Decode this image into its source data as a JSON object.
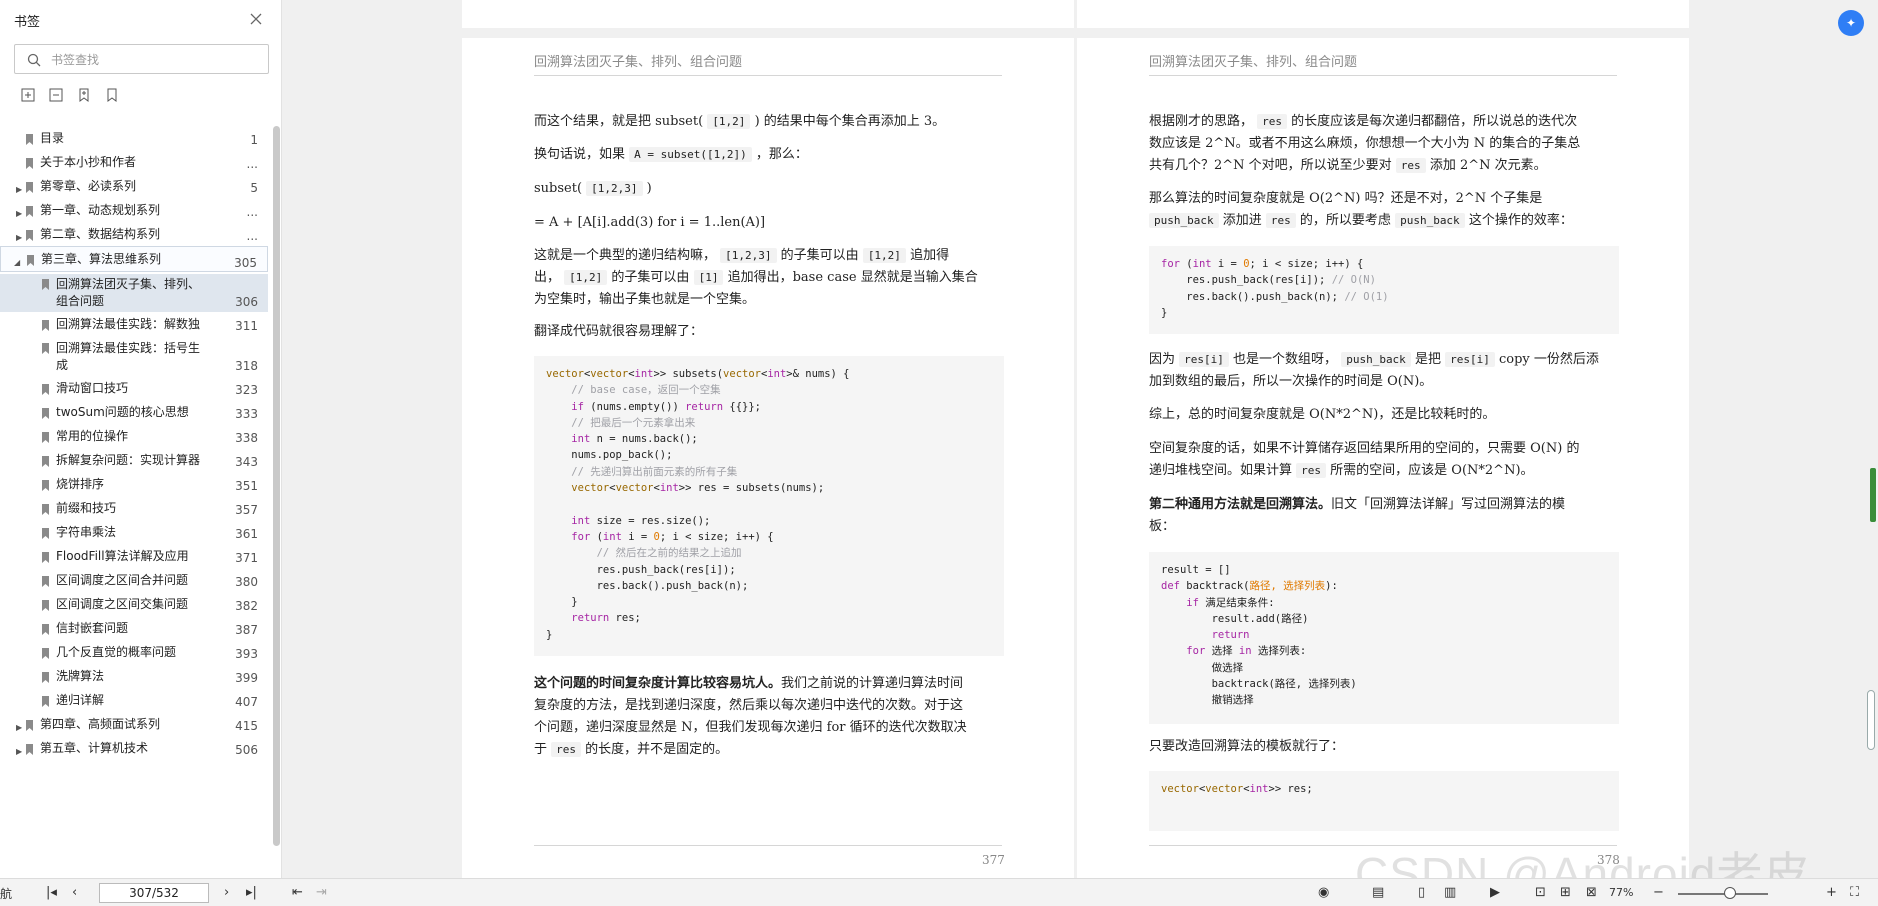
{
  "sidebar": {
    "title": "书签",
    "search_placeholder": "书签查找",
    "bookmarks": [
      {
        "label": "目录",
        "page": "1"
      },
      {
        "label": "关于本小抄和作者",
        "page": "..."
      },
      {
        "label": "第零章、必读系列",
        "page": "5"
      },
      {
        "label": "第一章、动态规划系列",
        "page": "..."
      },
      {
        "label": "第二章、数据结构系列",
        "page": "..."
      },
      {
        "label": "第三章、算法思维系列",
        "page": "305"
      },
      {
        "label": "回溯算法团灭子集、排列、",
        "label2": "组合问题",
        "page": "306"
      },
      {
        "label": "回溯算法最佳实践：解数独",
        "page": "311"
      },
      {
        "label": "回溯算法最佳实践：括号生",
        "label2": "成",
        "page": "318"
      },
      {
        "label": "滑动窗口技巧",
        "page": "323"
      },
      {
        "label": "twoSum问题的核心思想",
        "page": "333"
      },
      {
        "label": "常用的位操作",
        "page": "338"
      },
      {
        "label": "拆解复杂问题：实现计算器",
        "page": "343"
      },
      {
        "label": "烧饼排序",
        "page": "351"
      },
      {
        "label": "前缀和技巧",
        "page": "357"
      },
      {
        "label": "字符串乘法",
        "page": "361"
      },
      {
        "label": "FloodFill算法详解及应用",
        "page": "371"
      },
      {
        "label": "区间调度之区间合并问题",
        "page": "380"
      },
      {
        "label": "区间调度之区间交集问题",
        "page": "382"
      },
      {
        "label": "信封嵌套问题",
        "page": "387"
      },
      {
        "label": "几个反直觉的概率问题",
        "page": "393"
      },
      {
        "label": "洗牌算法",
        "page": "399"
      },
      {
        "label": "递归详解",
        "page": "407"
      },
      {
        "label": "第四章、高频面试系列",
        "page": "415"
      },
      {
        "label": "第五章、计算机技术",
        "page": "506"
      }
    ]
  },
  "left_page": {
    "running_head": "回溯算法团灭子集、排列、组合问题",
    "p1_a": "而这个结果，就是把 subset(",
    "p1_code": "[1,2]",
    "p1_b": ") 的结果中每个集合再添加上 3。",
    "p2_a": "换句话说，如果",
    "p2_code": "A = subset([1,2])",
    "p2_b": "，那么：",
    "p3_a": "subset(",
    "p3_code": "[1,2,3]",
    "p3_b": ")",
    "p4": "= A + [A[i].add(3) for i = 1..len(A)]",
    "p5_a": "这就是一个典型的递归结构嘛，",
    "p5_c1": "[1,2,3]",
    "p5_b": "的子集可以由",
    "p5_c2": "[1,2]",
    "p5_c": "追加得",
    "p5_d": "出，",
    "p5_c3": "[1,2]",
    "p5_e": "的子集可以由",
    "p5_c4": "[1]",
    "p5_f": "追加得出，base case 显然就是当输入集合",
    "p5_g": "为空集时，输出子集也就是一个空集。",
    "p6": "翻译成代码就很容易理解了：",
    "code_lines": [
      "vector<vector<int>> subsets(vector<int>& nums) {",
      "    // base case，返回一个空集",
      "    if (nums.empty()) return {{}};",
      "    // 把最后一个元素拿出来",
      "    int n = nums.back();",
      "    nums.pop_back();",
      "    // 先递归算出前面元素的所有子集",
      "    vector<vector<int>> res = subsets(nums);",
      "",
      "    int size = res.size();",
      "    for (int i = 0; i < size; i++) {",
      "        // 然后在之前的结果之上追加",
      "        res.push_back(res[i]);",
      "        res.back().push_back(n);",
      "    }",
      "    return res;",
      "}"
    ],
    "p7_bold": "这个问题的时间复杂度计算比较容易坑人。",
    "p7_a": "我们之前说的计算递归算法时间",
    "p7_b": "复杂度的方法，是找到递归深度，然后乘以每次递归中迭代的次数。对于这",
    "p7_c": "个问题，递归深度显然是 N，但我们发现每次递归 for 循环的迭代次数取决",
    "p7_d1": "于",
    "p7_code": "res",
    "p7_d2": "的长度，并不是固定的。",
    "page_number": "377"
  },
  "right_page": {
    "running_head": "回溯算法团灭子集、排列、组合问题",
    "q1_a": "根据刚才的思路，",
    "q1_code": "res",
    "q1_b": "的长度应该是每次递归都翻倍，所以说总的迭代次",
    "q1_c": "数应该是 2^N。或者不用这么麻烦，你想想一个大小为 N 的集合的子集总",
    "q1_d": "共有几个？2^N 个对吧，所以说至少要对",
    "q1_code2": "res",
    "q1_e": "添加 2^N 次元素。",
    "q2_a": "那么算法的时间复杂度就是 O(2^N) 吗？还是不对，2^N 个子集是",
    "q2_c1": "push_back",
    "q2_b": "添加进",
    "q2_c2": "res",
    "q2_c": "的，所以要考虑",
    "q2_c3": "push_back",
    "q2_d": "这个操作的效率：",
    "code1_lines": [
      "for (int i = 0; i < size; i++) {",
      "    res.push_back(res[i]); // O(N)",
      "    res.back().push_back(n); // O(1)",
      "}"
    ],
    "q3_a": "因为",
    "q3_c1": "res[i]",
    "q3_b": "也是一个数组呀，",
    "q3_c2": "push_back",
    "q3_c": "是把",
    "q3_c3": "res[i]",
    "q3_d": "copy 一份然后添",
    "q3_e": "加到数组的最后，所以一次操作的时间是 O(N)。",
    "q4": "综上，总的时间复杂度就是 O(N*2^N)，还是比较耗时的。",
    "q5_a": "空间复杂度的话，如果不计算储存返回结果所用的空间的，只需要 O(N) 的",
    "q5_b": "递归堆栈空间。如果计算",
    "q5_code": "res",
    "q5_c": "所需的空间，应该是 O(N*2^N)。",
    "q6_bold": "第二种通用方法就是回溯算法。",
    "q6_a": "旧文「回溯算法详解」写过回溯算法的模",
    "q6_b": "板：",
    "code2_lines": [
      "result = []",
      "def backtrack(路径, 选择列表):",
      "    if 满足结束条件:",
      "        result.add(路径)",
      "        return",
      "    for 选择 in 选择列表:",
      "        做选择",
      "        backtrack(路径, 选择列表)",
      "        撤销选择"
    ],
    "q7": "只要改造回溯算法的模板就行了：",
    "code3_lines": [
      "vector<vector<int>> res;"
    ],
    "page_number": "378"
  },
  "statusbar": {
    "left_label": "航",
    "page_value": "307/532",
    "zoom": "77%"
  },
  "watermark": "CSDN @Android老皮",
  "colors": {
    "accent": "#2f7ef5",
    "selected_bg": "#dfe6ee",
    "code_bg": "#f5f5f5"
  }
}
